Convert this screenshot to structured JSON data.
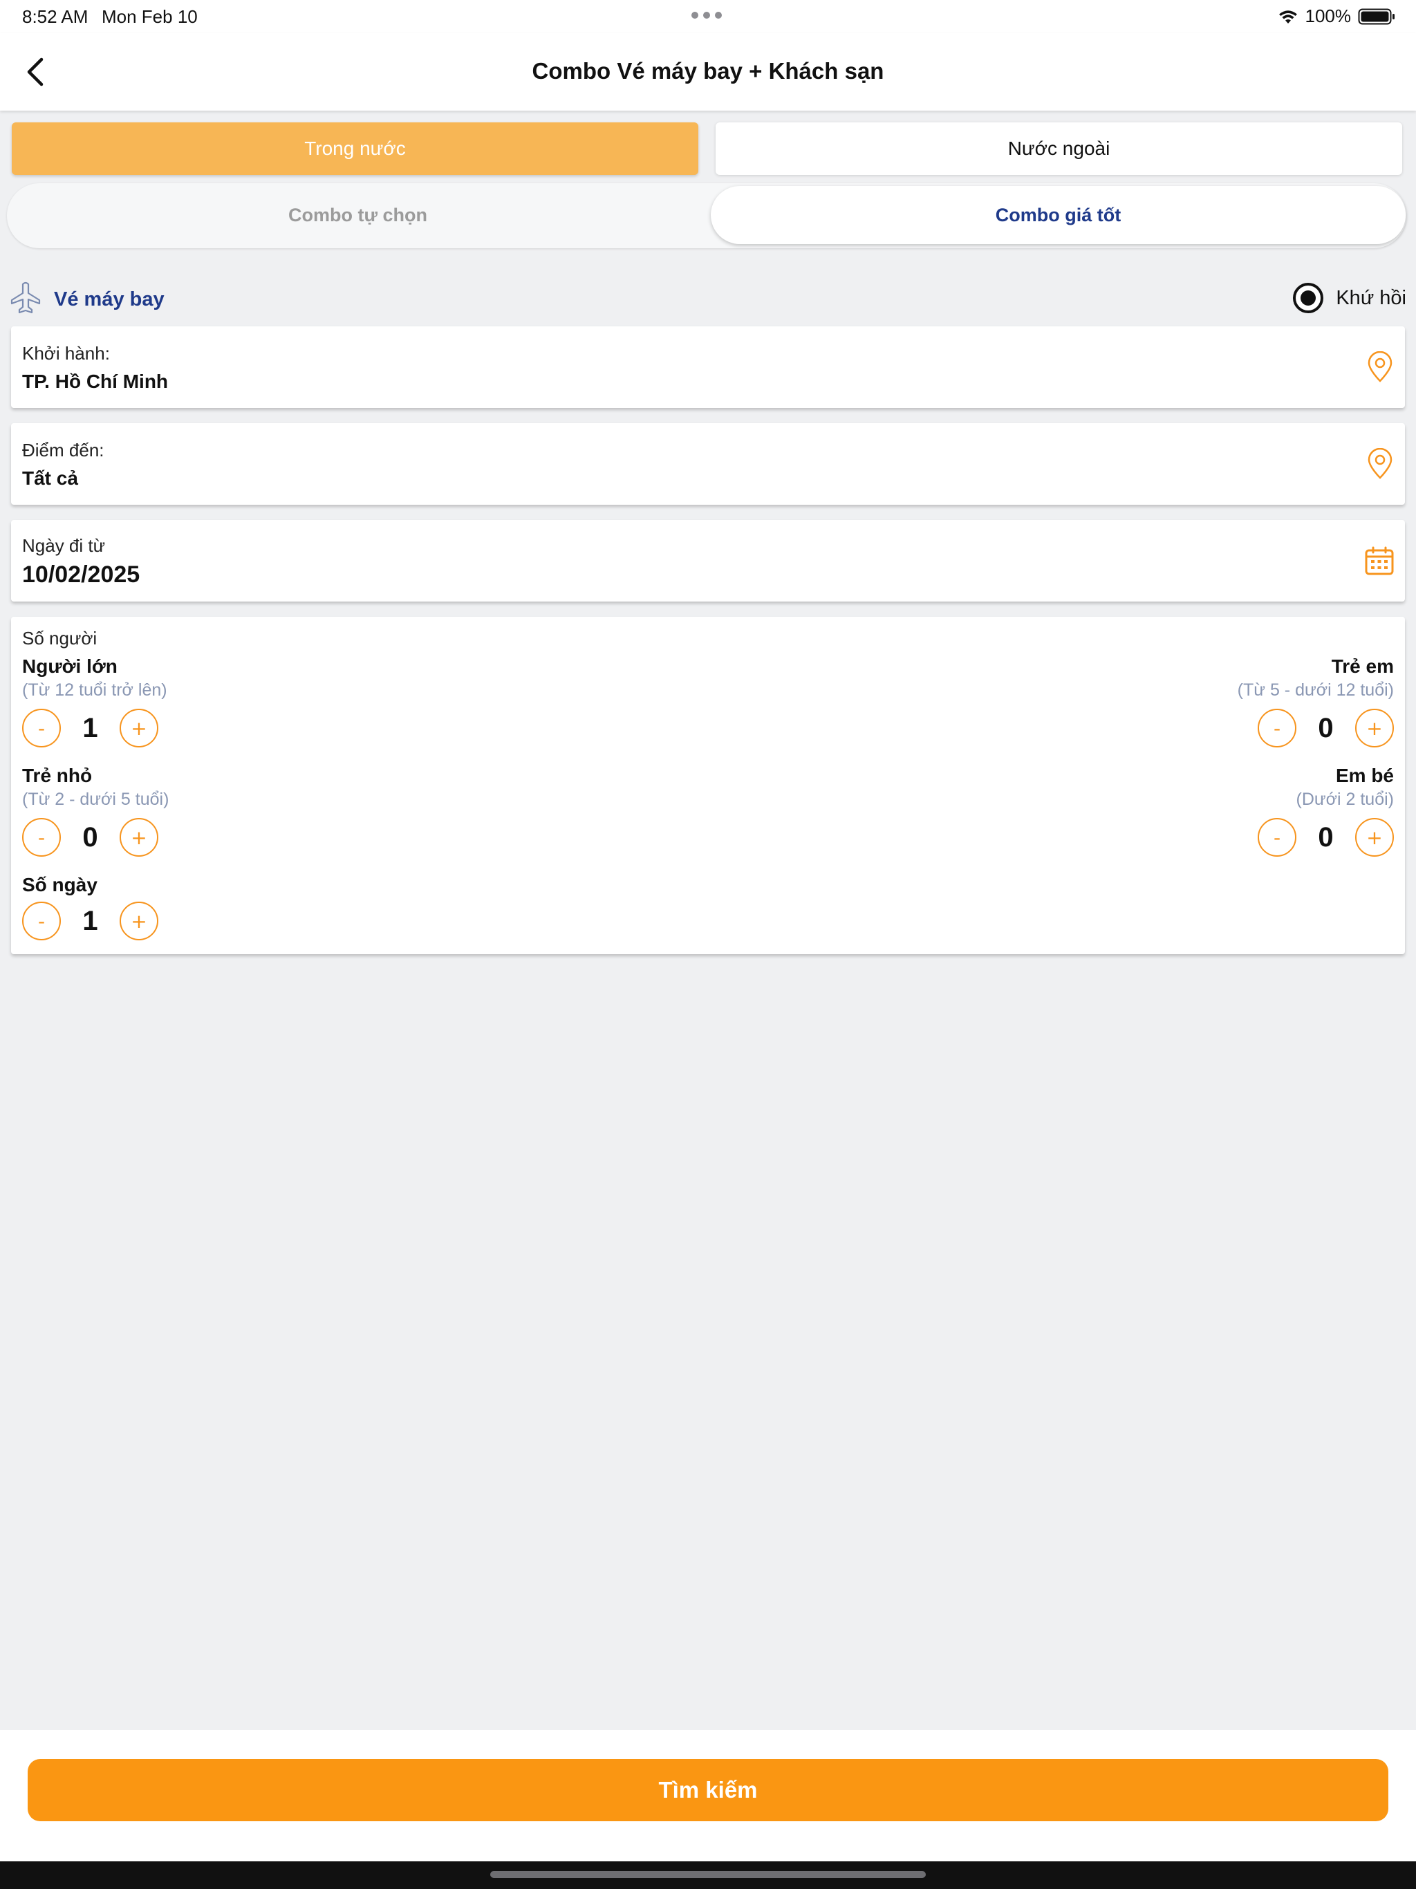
{
  "status_bar": {
    "time": "8:52 AM",
    "date": "Mon Feb 10",
    "battery": "100%"
  },
  "header": {
    "title": "Combo Vé máy bay + Khách sạn",
    "back_icon": "chevron-left-icon"
  },
  "region_tabs": {
    "domestic": "Trong nước",
    "foreign": "Nước ngoài",
    "selected": "domestic"
  },
  "combo_tabs": {
    "custom": "Combo tự chọn",
    "best_price": "Combo giá tốt",
    "selected": "best_price"
  },
  "flight": {
    "label": "Vé máy bay",
    "roundtrip_label": "Khứ hồi",
    "roundtrip_selected": true
  },
  "departure": {
    "label": "Khởi hành:",
    "value": "TP. Hồ Chí Minh"
  },
  "destination": {
    "label": "Điểm đến:",
    "value": "Tất cả"
  },
  "date": {
    "label": "Ngày đi từ",
    "value": "10/02/2025"
  },
  "people": {
    "title": "Số người",
    "adult": {
      "name": "Người lớn",
      "desc": "(Từ 12 tuổi trở lên)",
      "count": "1"
    },
    "child": {
      "name": "Trẻ em",
      "desc": "(Từ 5 - dưới 12 tuổi)",
      "count": "0"
    },
    "toddler": {
      "name": "Trẻ nhỏ",
      "desc": "(Từ 2 - dưới 5 tuổi)",
      "count": "0"
    },
    "infant": {
      "name": "Em bé",
      "desc": "(Dưới 2 tuổi)",
      "count": "0"
    },
    "days": {
      "name": "Số ngày",
      "count": "1"
    },
    "minus": "-",
    "plus": "+"
  },
  "search_button": "Tìm kiếm",
  "colors": {
    "accent": "#fa9612",
    "tab_selected": "#f7b655",
    "navy": "#1f3a8a",
    "hint": "#8a97b3",
    "background": "#eff0f2"
  }
}
